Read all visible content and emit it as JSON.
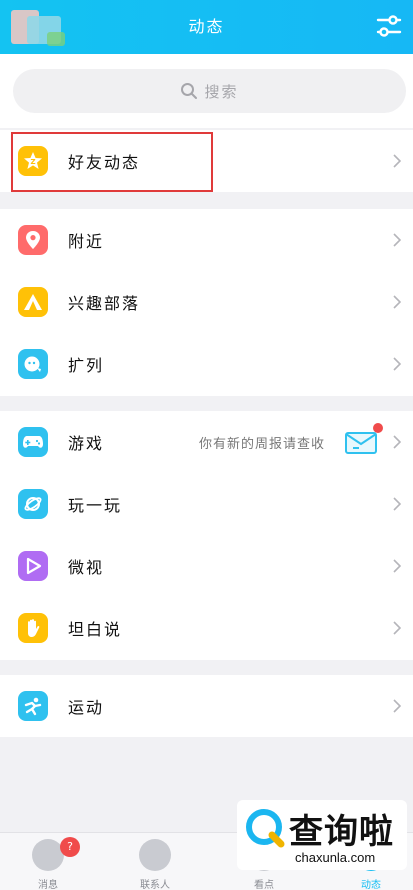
{
  "header": {
    "title": "动态"
  },
  "search": {
    "placeholder": "搜索"
  },
  "groups": {
    "friends": [
      {
        "label": "好友动态",
        "icon": "star-icon",
        "color": "#ffc107"
      }
    ],
    "discover": [
      {
        "label": "附近",
        "icon": "location-pin-icon",
        "color": "#ff6b6b"
      },
      {
        "label": "兴趣部落",
        "icon": "tent-icon",
        "color": "#ffc107"
      },
      {
        "label": "扩列",
        "icon": "chat-face-icon",
        "color": "#2fc1ef"
      }
    ],
    "fun": [
      {
        "label": "游戏",
        "icon": "gamepad-icon",
        "color": "#2fc1ef",
        "note": "你有新的周报请查收"
      },
      {
        "label": "玩一玩",
        "icon": "planet-icon",
        "color": "#2fc1ef"
      },
      {
        "label": "微视",
        "icon": "play-icon",
        "color": "#b06cf3"
      },
      {
        "label": "坦白说",
        "icon": "hand-icon",
        "color": "#ffc107"
      }
    ],
    "sport": [
      {
        "label": "运动",
        "icon": "runner-icon",
        "color": "#2fc1ef"
      }
    ]
  },
  "tabbar": {
    "items": [
      {
        "label": "消息",
        "badge": "?"
      },
      {
        "label": "联系人"
      },
      {
        "label": "看点"
      },
      {
        "label": "动态"
      }
    ]
  },
  "watermark": {
    "brand": "查询啦",
    "url": "chaxunla.com"
  }
}
